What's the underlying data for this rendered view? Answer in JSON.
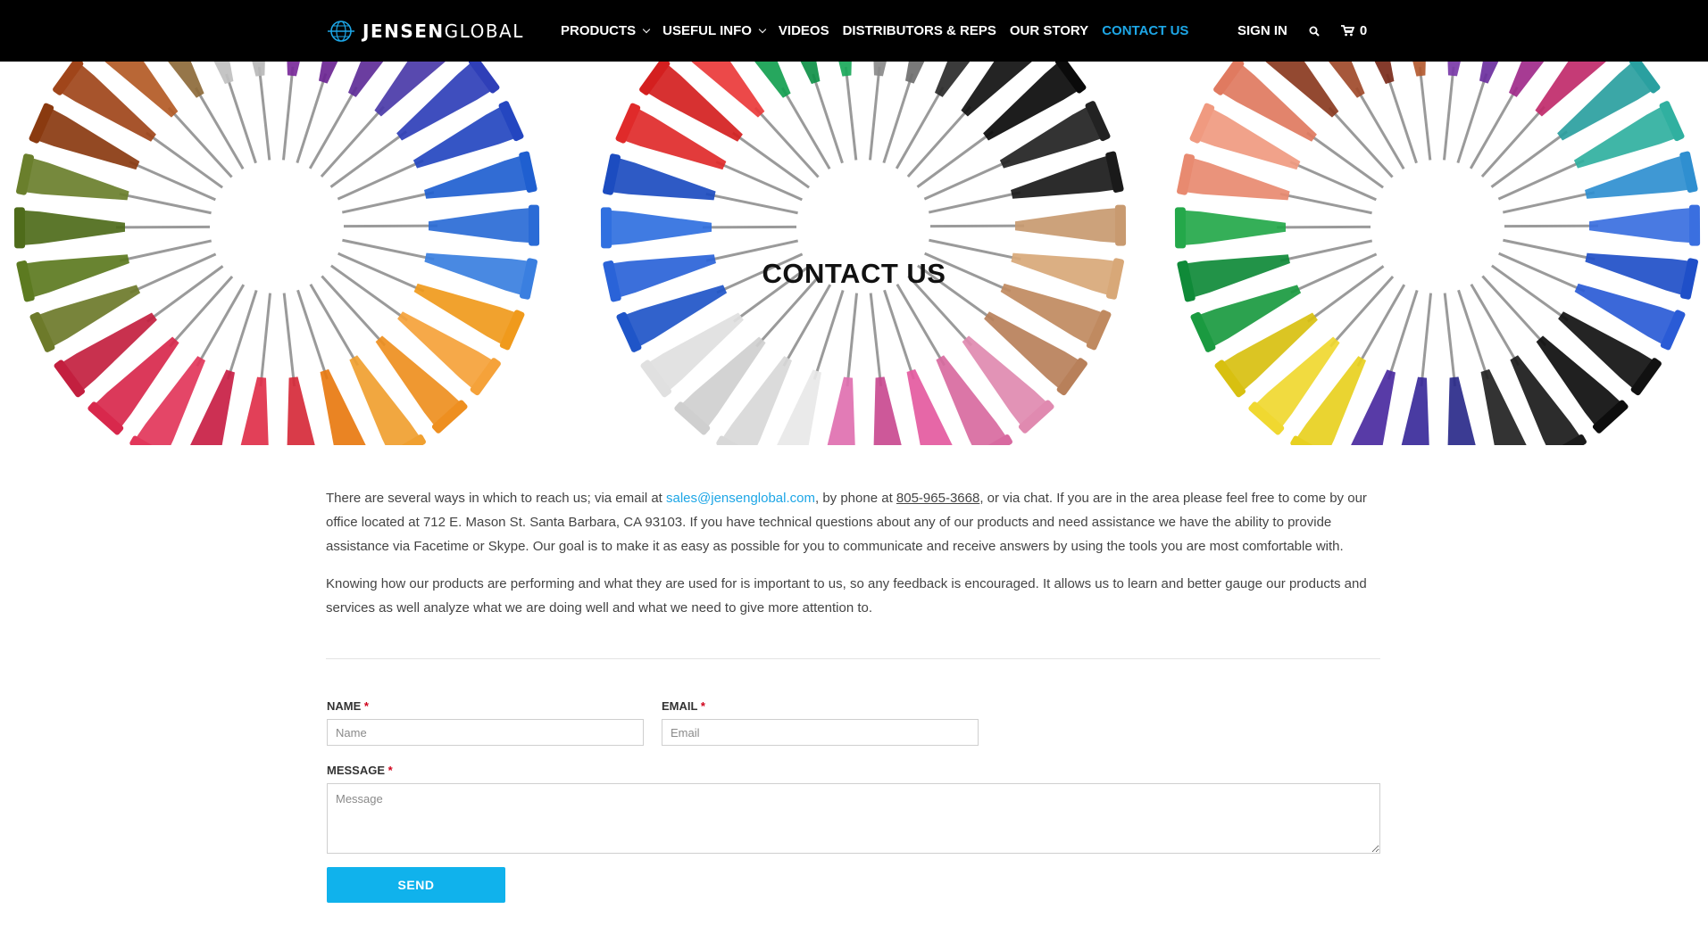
{
  "brand": {
    "name_bold": "JENSEN",
    "name_light": "GLOBAL"
  },
  "nav": [
    {
      "label": "PRODUCTS",
      "dropdown": true
    },
    {
      "label": "USEFUL INFO",
      "dropdown": true
    },
    {
      "label": "VIDEOS",
      "dropdown": false
    },
    {
      "label": "DISTRIBUTORS & REPS",
      "dropdown": false
    },
    {
      "label": "OUR STORY",
      "dropdown": false
    },
    {
      "label": "CONTACT US",
      "dropdown": false,
      "active": true
    }
  ],
  "utility": {
    "sign_in": "SIGN IN",
    "cart_count": "0",
    "icons": [
      "search-icon",
      "cart-icon"
    ]
  },
  "hero": {
    "title": "CONTACT US",
    "wheels": [
      [
        "#7a2a9a",
        "#6b2593",
        "#5e2c98",
        "#4a3aa8",
        "#2f3fb8",
        "#2446c0",
        "#1f5fd0",
        "#2a6bd6",
        "#3a7fe0",
        "#f09a1c",
        "#f5a23a",
        "#ee8f20",
        "#f0a030",
        "#e87a10",
        "#d62a3a",
        "#e0304a",
        "#c81e44",
        "#e2365a",
        "#d8284c",
        "#c31f3f",
        "#6d7a2a",
        "#5c7a20",
        "#4e6b1a",
        "#6a7f2c",
        "#8a3a10",
        "#a0451a",
        "#b35a25",
        "#8d6a3a",
        "#c0c0c0",
        "#b8b8b8"
      ],
      [
        "#8a8a8a",
        "#6f6f6f",
        "#2a2a2a",
        "#111111",
        "#0a0a0a",
        "#222222",
        "#1a1a1a",
        "#c89a70",
        "#d8a878",
        "#c08a60",
        "#b8805a",
        "#e08ab0",
        "#d86aa0",
        "#e45aa0",
        "#c94a90",
        "#e070b0",
        "#e8e8e8",
        "#d8d8d8",
        "#cfcfcf",
        "#e0e0e0",
        "#1f55c8",
        "#2a63d8",
        "#3070e0",
        "#1c4cc0",
        "#e02a2a",
        "#d41f1f",
        "#ea3a3a",
        "#14a050",
        "#0f9048",
        "#1aa85a"
      ],
      [
        "#7a3aa8",
        "#6b2f9e",
        "#a02a8a",
        "#c02a6a",
        "#2aa0a0",
        "#30b0a0",
        "#2f8fd0",
        "#3a6fe0",
        "#1f4fc8",
        "#2a5bd6",
        "#111111",
        "#0d0d0d",
        "#1a1a1a",
        "#222222",
        "#2a2a8a",
        "#3a2a9a",
        "#4a2aa0",
        "#e8d020",
        "#f0d830",
        "#d8c010",
        "#1a9a40",
        "#0f8a38",
        "#24a84a",
        "#e88a70",
        "#f09a80",
        "#e07a60",
        "#8a3a20",
        "#a04a2a",
        "#7a2a1a",
        "#b35a30"
      ]
    ]
  },
  "intro": {
    "p1_before_email": "There are several ways in which to reach us; via email at ",
    "email": "sales@jensenglobal.com",
    "p1_before_phone": ", by phone at ",
    "phone": "805-965-3668",
    "p1_rest": ", or via chat.  If you are in the area please feel free to come by our office located at 712 E. Mason St. Santa Barbara, CA 93103.  If you have technical questions about any of our products and need assistance we have the ability to provide assistance via Facetime or Skype.  Our goal is to make it as easy as possible for you to communicate and receive answers by using the tools you are most comfortable with.",
    "p2": "Knowing how our products are performing and what they are used for is important to us, so any feedback is encouraged. It allows us to learn and better gauge our products and services as well analyze what we are doing well and what we need to give more attention to."
  },
  "form": {
    "name_label": "NAME",
    "name_placeholder": "Name",
    "email_label": "EMAIL",
    "email_placeholder": "Email",
    "message_label": "MESSAGE",
    "message_placeholder": "Message",
    "required_marker": "*",
    "send_label": "SEND"
  },
  "colors": {
    "accent": "#1da6e6",
    "button": "#10b2ec",
    "header_bg": "#000000",
    "required": "#d0021b"
  }
}
